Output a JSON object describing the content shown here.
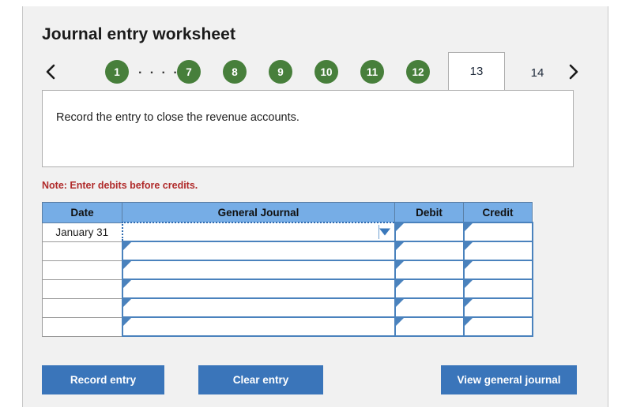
{
  "header": {
    "title": "Journal entry worksheet"
  },
  "nav": {
    "prev_icon": "chevron-left-icon",
    "next_icon": "chevron-right-icon",
    "ellipsis": "· · · · ·",
    "steps": [
      {
        "label": "1",
        "state": "completed"
      },
      {
        "label": "7",
        "state": "completed"
      },
      {
        "label": "8",
        "state": "completed"
      },
      {
        "label": "9",
        "state": "completed"
      },
      {
        "label": "10",
        "state": "completed"
      },
      {
        "label": "11",
        "state": "completed"
      },
      {
        "label": "12",
        "state": "completed"
      },
      {
        "label": "13",
        "state": "active"
      },
      {
        "label": "14",
        "state": "upcoming"
      }
    ]
  },
  "instruction": {
    "text": "Record the entry to close the revenue accounts."
  },
  "note": {
    "text": "Note: Enter debits before credits."
  },
  "table": {
    "columns": [
      "Date",
      "General Journal",
      "Debit",
      "Credit"
    ],
    "rows": [
      {
        "date": "January 31",
        "general_journal": "",
        "debit": "",
        "credit": "",
        "selected": true
      },
      {
        "date": "",
        "general_journal": "",
        "debit": "",
        "credit": "",
        "selected": false
      },
      {
        "date": "",
        "general_journal": "",
        "debit": "",
        "credit": "",
        "selected": false
      },
      {
        "date": "",
        "general_journal": "",
        "debit": "",
        "credit": "",
        "selected": false
      },
      {
        "date": "",
        "general_journal": "",
        "debit": "",
        "credit": "",
        "selected": false
      },
      {
        "date": "",
        "general_journal": "",
        "debit": "",
        "credit": "",
        "selected": false
      }
    ]
  },
  "buttons": {
    "record": "Record entry",
    "clear": "Clear entry",
    "view": "View general journal"
  },
  "colors": {
    "step_green": "#477f3b",
    "table_header_blue": "#76ade6",
    "button_blue": "#3a75ba",
    "note_red": "#b02a2a",
    "cell_border_blue": "#4a82bd",
    "panel_gray": "#f1f1f1"
  }
}
